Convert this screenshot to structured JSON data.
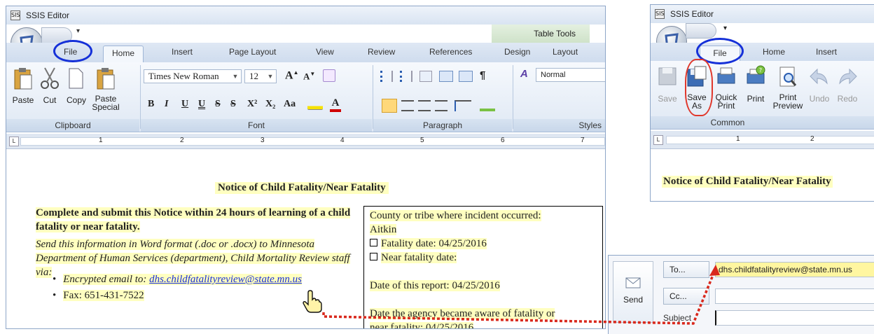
{
  "left_window": {
    "title": "SSIS Editor",
    "app_icon": "SIS",
    "contextual_group": "Table Tools",
    "tabs": [
      "File",
      "Home",
      "Insert",
      "Page Layout",
      "View",
      "Review",
      "References",
      "Design",
      "Layout"
    ],
    "clipboard": {
      "paste": "Paste",
      "cut": "Cut",
      "copy": "Copy",
      "paste_special_1": "Paste",
      "paste_special_2": "Special",
      "group": "Clipboard"
    },
    "font": {
      "name": "Times New Roman",
      "size": "12",
      "group": "Font",
      "bold": "B",
      "italic": "I",
      "underline": "U",
      "double_underline": "U",
      "strike": "S",
      "double_strike": "S",
      "superscript": "X²",
      "subscript": "X₂",
      "change_case": "Aa",
      "grow": "A",
      "shrink": "A"
    },
    "paragraph": {
      "group": "Paragraph"
    },
    "styles": {
      "current": "Normal",
      "group": "Styles"
    },
    "ruler_numbers": [
      "1",
      "2",
      "3",
      "4",
      "5",
      "6",
      "7"
    ],
    "document": {
      "heading": "Notice of Child Fatality/Near Fatality",
      "instruction_bold": "Complete and submit this Notice within 24 hours of learning of a child fatality or near fatality.",
      "send_italic": "Send this information in Word format (.doc or .docx) to Minnesota Department of Human Services (department), Child Mortality Review staff via:",
      "bullet_email_label": "Encrypted email to: ",
      "bullet_email_link": "dhs.childfatalityreview@state.mn.us",
      "bullet_fax": "Fax: 651-431-7522",
      "box": {
        "county_label": "County or tribe where incident occurred:",
        "county_value": "Aitkin",
        "fatality": "Fatality date:  04/25/2016",
        "near_fatality": "Near fatality date:",
        "report_date": "Date of this report:  04/25/2016",
        "aware_line1": "Date the agency became aware of fatality or",
        "aware_line2": "near fatality:  04/25/2016"
      }
    }
  },
  "right_window": {
    "title": "SSIS Editor",
    "app_icon": "SIS",
    "tabs": [
      "File",
      "Home",
      "Insert"
    ],
    "buttons": [
      {
        "l1": "Save",
        "l2": ""
      },
      {
        "l1": "Save",
        "l2": "As"
      },
      {
        "l1": "Quick",
        "l2": "Print"
      },
      {
        "l1": "Print",
        "l2": ""
      },
      {
        "l1": "Print",
        "l2": "Preview"
      },
      {
        "l1": "Undo",
        "l2": ""
      },
      {
        "l1": "Redo",
        "l2": ""
      }
    ],
    "group": "Common",
    "ruler_numbers": [
      "1",
      "2"
    ],
    "heading": "Notice of Child Fatality/Near Fatality"
  },
  "email": {
    "send": "Send",
    "to_label": "To...",
    "cc_label": "Cc...",
    "subject_label": "Subject",
    "to_value": "dhs.childfatalityreview@state.mn.us"
  },
  "colors": {
    "circle": "#1530d8",
    "arrow": "#d9281c",
    "highlight": "#ffffc0"
  }
}
